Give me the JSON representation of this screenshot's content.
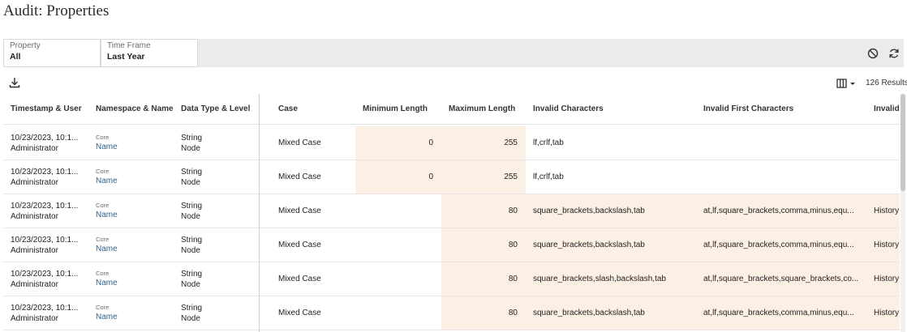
{
  "page": {
    "title": "Audit: Properties"
  },
  "filters": [
    {
      "label": "Property",
      "value": "All"
    },
    {
      "label": "Time Frame",
      "value": "Last Year"
    }
  ],
  "icons": {
    "clear": "ban-icon",
    "refresh": "refresh-icon",
    "download": "download-icon",
    "columns": "columns-icon"
  },
  "toolbar": {
    "results": "126 Results"
  },
  "columns": [
    "Timestamp & User",
    "Namespace & Name",
    "Data Type & Level",
    "Case",
    "Minimum Length",
    "Maximum Length",
    "Invalid Characters",
    "Invalid First Characters",
    "Invalid"
  ],
  "rows": [
    {
      "timestamp": "10/23/2023, 10:1...",
      "user": "Administrator",
      "namespace": "Core",
      "name": "Name",
      "data_type": "String",
      "level": "Node",
      "case": "Mixed Case",
      "min_length": "0",
      "max_length": "255",
      "invalid_chars": "lf,crlf,tab",
      "invalid_first": "",
      "invalid_last": ""
    },
    {
      "timestamp": "10/23/2023, 10:1...",
      "user": "Administrator",
      "namespace": "Core",
      "name": "Name",
      "data_type": "String",
      "level": "Node",
      "case": "Mixed Case",
      "min_length": "0",
      "max_length": "255",
      "invalid_chars": "lf,crlf,tab",
      "invalid_first": "",
      "invalid_last": ""
    },
    {
      "timestamp": "10/23/2023, 10:1...",
      "user": "Administrator",
      "namespace": "Core",
      "name": "Name",
      "data_type": "String",
      "level": "Node",
      "case": "Mixed Case",
      "min_length": "",
      "max_length": "80",
      "invalid_chars": "square_brackets,backslash,tab",
      "invalid_first": "at,lf,square_brackets,comma,minus,equ...",
      "invalid_last": "History"
    },
    {
      "timestamp": "10/23/2023, 10:1...",
      "user": "Administrator",
      "namespace": "Core",
      "name": "Name",
      "data_type": "String",
      "level": "Node",
      "case": "Mixed Case",
      "min_length": "",
      "max_length": "80",
      "invalid_chars": "square_brackets,backslash,tab",
      "invalid_first": "at,lf,square_brackets,comma,minus,equ...",
      "invalid_last": "History"
    },
    {
      "timestamp": "10/23/2023, 10:1...",
      "user": "Administrator",
      "namespace": "Core",
      "name": "Name",
      "data_type": "String",
      "level": "Node",
      "case": "Mixed Case",
      "min_length": "",
      "max_length": "80",
      "invalid_chars": "square_brackets,slash,backslash,tab",
      "invalid_first": "at,lf,square_brackets,square_brackets,co...",
      "invalid_last": "History"
    },
    {
      "timestamp": "10/23/2023, 10:1...",
      "user": "Administrator",
      "namespace": "Core",
      "name": "Name",
      "data_type": "String",
      "level": "Node",
      "case": "Mixed Case",
      "min_length": "",
      "max_length": "80",
      "invalid_chars": "square_brackets,backslash,tab",
      "invalid_first": "at,lf,square_brackets,comma,minus,equ...",
      "invalid_last": "History"
    }
  ]
}
